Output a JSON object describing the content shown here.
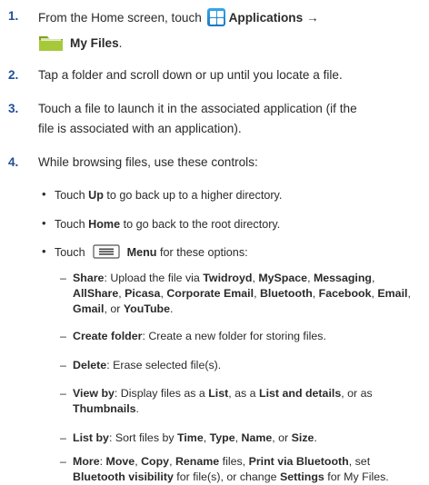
{
  "steps": [
    {
      "number": "1.",
      "line1_pre": "From the Home screen, touch",
      "apps_label": "Applications",
      "arrow": "→",
      "myfiles_label": "My Files",
      "period": "."
    },
    {
      "number": "2.",
      "text": "Tap a folder and scroll down or up until you locate a file."
    },
    {
      "number": "3.",
      "line1": "Touch a file to launch it in the associated application (if the",
      "line2": "file is associated with an application)."
    },
    {
      "number": "4.",
      "text": "While browsing files, use these controls:"
    }
  ],
  "bullets": {
    "up": {
      "pre": "Touch",
      "bold": "Up",
      "post": "to go back up to a higher directory."
    },
    "home": {
      "pre": "Touch",
      "bold": "Home",
      "post": "to go back to the root directory."
    },
    "menu": {
      "pre": "Touch",
      "bold": "Menu",
      "post": "for these options:"
    }
  },
  "options": {
    "share": {
      "label": "Share",
      "t1": ": Upload the file via",
      "twidroyd": "Twidroyd",
      "myspace": "MySpace",
      "messaging": "Messaging",
      "allshare": "AllShare",
      "picasa": "Picasa",
      "corporate_email": "Corporate Email",
      "bluetooth": "Bluetooth",
      "facebook": "Facebook",
      "email": "Email",
      "gmail": "Gmail",
      "or": "or",
      "youtube": "YouTube"
    },
    "create_folder": {
      "label": "Create folder",
      "text": ": Create a new folder for storing files."
    },
    "delete": {
      "label": "Delete",
      "text": ": Erase selected file(s)."
    },
    "view_by": {
      "label": "View by",
      "t1": ":  Display files as a",
      "list": "List",
      "t2": ", as a",
      "list_details": "List and details",
      "t3": ", or as",
      "thumbnails": "Thumbnails"
    },
    "list_by": {
      "label": "List by",
      "t1": ": Sort files by",
      "time": "Time",
      "type": "Type",
      "name": "Name",
      "or": "or",
      "size": "Size"
    },
    "more": {
      "label": "More",
      "move": "Move",
      "copy": "Copy",
      "rename": "Rename",
      "t1": "files,",
      "print": "Print via Bluetooth",
      "t2": ", set",
      "bt_visibility": "Bluetooth visibility",
      "t3": "for file(s), or change",
      "settings": "Settings",
      "t4": "for My Files."
    }
  },
  "colors": {
    "step_number": "#1f4e9c",
    "apps_icon": "#1b79c4",
    "folder": "#9bbf28"
  },
  "icons": {
    "applications": "grid-icon",
    "my_files": "folder-icon",
    "menu": "menu-icon"
  }
}
